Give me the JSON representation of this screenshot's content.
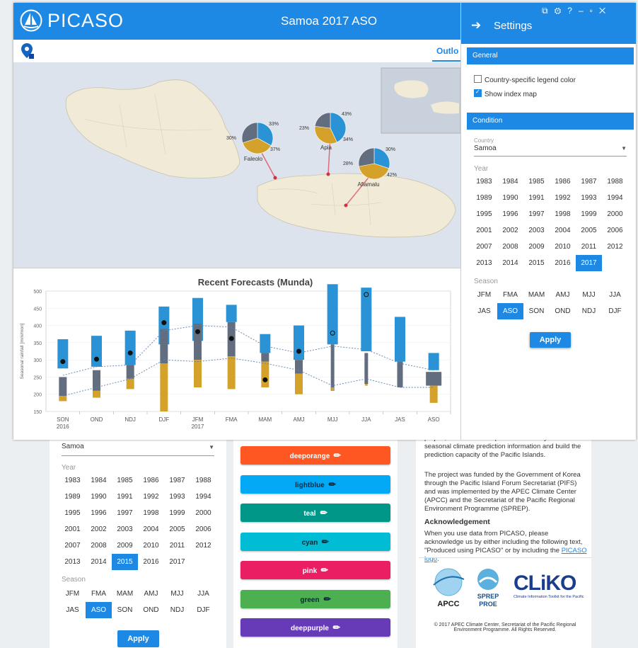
{
  "app": {
    "logo": "PICASO",
    "title": "Samoa 2017 ASO",
    "tab_outlook": "Outlo"
  },
  "map": {
    "sites": [
      {
        "name": "Faleolo",
        "left_pct": "30%",
        "top_pct": "33%",
        "bottom_pct": "37%"
      },
      {
        "name": "Apia",
        "left_pct": "23%",
        "top_pct": "43%",
        "bottom_pct": "34%"
      },
      {
        "name": "Afiamalu",
        "left_pct": "28%",
        "top_pct": "30%",
        "bottom_pct": "42%"
      }
    ]
  },
  "chart_data": {
    "type": "bar",
    "title": "Recent Forecasts (Munda)",
    "ylabel": "Seasonal rainfall [mm/mon]",
    "ylim": [
      150,
      500
    ],
    "yticks": [
      150,
      200,
      250,
      300,
      350,
      400,
      450,
      500
    ],
    "categories": [
      "SON 2016",
      "OND",
      "NDJ",
      "DJF",
      "JFM 2017",
      "FMA",
      "MAM",
      "AMJ",
      "MJJ",
      "JJA",
      "JAS",
      "ASO"
    ],
    "x_tick_lines": [
      [
        "SON",
        "2016"
      ],
      [
        "OND"
      ],
      [
        "NDJ"
      ],
      [
        "DJF"
      ],
      [
        "JFM",
        "2017"
      ],
      [
        "FMA"
      ],
      [
        "MAM"
      ],
      [
        "AMJ"
      ],
      [
        "MJJ"
      ],
      [
        "JJA"
      ],
      [
        "JAS"
      ],
      [
        "ASO"
      ]
    ],
    "above_normal": [
      [
        275,
        360
      ],
      [
        280,
        370
      ],
      [
        285,
        385
      ],
      [
        345,
        455
      ],
      [
        355,
        480
      ],
      [
        410,
        460
      ],
      [
        320,
        375
      ],
      [
        300,
        400
      ],
      [
        345,
        520
      ],
      [
        325,
        510
      ],
      [
        295,
        425
      ],
      [
        270,
        320
      ]
    ],
    "normal": [
      [
        195,
        250
      ],
      [
        210,
        270
      ],
      [
        245,
        285
      ],
      [
        290,
        390
      ],
      [
        300,
        405
      ],
      [
        310,
        410
      ],
      [
        295,
        320
      ],
      [
        260,
        300
      ],
      [
        210,
        345
      ],
      [
        230,
        320
      ],
      [
        220,
        295
      ],
      [
        225,
        265
      ]
    ],
    "below_normal": [
      [
        180,
        195
      ],
      [
        190,
        210
      ],
      [
        215,
        245
      ],
      [
        150,
        290
      ],
      [
        220,
        300
      ],
      [
        215,
        310
      ],
      [
        220,
        295
      ],
      [
        200,
        260
      ],
      [
        210,
        220
      ],
      [
        225,
        230
      ],
      [
        220,
        220
      ],
      [
        175,
        225
      ]
    ],
    "observed": [
      295,
      302,
      320,
      408,
      382,
      362,
      242,
      325,
      378,
      490,
      null,
      null
    ],
    "observed_open": [
      false,
      false,
      false,
      false,
      false,
      false,
      false,
      false,
      true,
      true,
      false,
      false
    ],
    "upper_curve": [
      255,
      280,
      285,
      385,
      400,
      395,
      340,
      320,
      340,
      330,
      290,
      270
    ],
    "lower_curve": [
      195,
      220,
      245,
      300,
      295,
      305,
      290,
      270,
      225,
      245,
      220,
      220
    ],
    "colors": {
      "above": "#2a93d5",
      "normal": "#626e80",
      "below": "#d4a22b",
      "obs": "#111111",
      "curve": "#5a7fb2"
    }
  },
  "settings": {
    "title": "Settings",
    "general": "General",
    "country_legend": "Country-specific legend color",
    "country_legend_checked": false,
    "index_map": "Show index map",
    "index_map_checked": true,
    "condition": "Condition",
    "country_label": "Country",
    "country_value": "Samoa",
    "year_label": "Year",
    "years": [
      "1983",
      "1984",
      "1985",
      "1986",
      "1987",
      "1988",
      "1989",
      "1990",
      "1991",
      "1992",
      "1993",
      "1994",
      "1995",
      "1996",
      "1997",
      "1998",
      "1999",
      "2000",
      "2001",
      "2002",
      "2003",
      "2004",
      "2005",
      "2006",
      "2007",
      "2008",
      "2009",
      "2010",
      "2011",
      "2012",
      "2013",
      "2014",
      "2015",
      "2016",
      "2017"
    ],
    "selected_year": "2017",
    "season_label": "Season",
    "seasons": [
      "JFM",
      "FMA",
      "MAM",
      "AMJ",
      "MJJ",
      "JJA",
      "JAS",
      "ASO",
      "SON",
      "OND",
      "NDJ",
      "DJF"
    ],
    "selected_season": "ASO",
    "apply": "Apply"
  },
  "background": {
    "country_value": "Samoa",
    "year_label": "Year",
    "selected_year": "2015",
    "season_label": "Season",
    "selected_season": "ASO",
    "apply": "Apply",
    "color_buttons": [
      {
        "label": "deeporange",
        "color": "#ff5722",
        "dark": false
      },
      {
        "label": "lightblue",
        "color": "#03a9f4",
        "dark": true
      },
      {
        "label": "teal",
        "color": "#009688",
        "dark": false
      },
      {
        "label": "cyan",
        "color": "#00bcd4",
        "dark": true
      },
      {
        "label": "pink",
        "color": "#e91e63",
        "dark": false
      },
      {
        "label": "green",
        "color": "#4caf50",
        "dark": true
      },
      {
        "label": "deeppurple",
        "color": "#673ab7",
        "dark": false
      }
    ],
    "para1": "project, which aimed to provide nationally-tailored seasonal climate prediction information and build the prediction capacity of the Pacific Islands.",
    "para2": "The project was funded by the Government of Korea through the Pacific Island Forum Secretariat (PIFS) and was implemented by the APEC Climate Center (APCC) and the Secretariat of the Pacific Regional Environment Programme (SPREP).",
    "ack_title": "Acknowledgement",
    "ack_text": "When you use data from PICASO, please acknowledge us by either including the following text, \"Produced using PICASO\" or by including the",
    "ack_link": "PICASO logo",
    "logo_apcc": "APCC",
    "logo_sprep": "SPREP",
    "logo_sprep2": "PROE",
    "logo_cliko": "CLiKO",
    "logo_cliko_sub": "Climate Information Toolkit for the Pacific",
    "copyright": "© 2017 APEC Climate Center, Secretariat of the Pacific Regional Environment Programme. All Rights Reserved."
  }
}
